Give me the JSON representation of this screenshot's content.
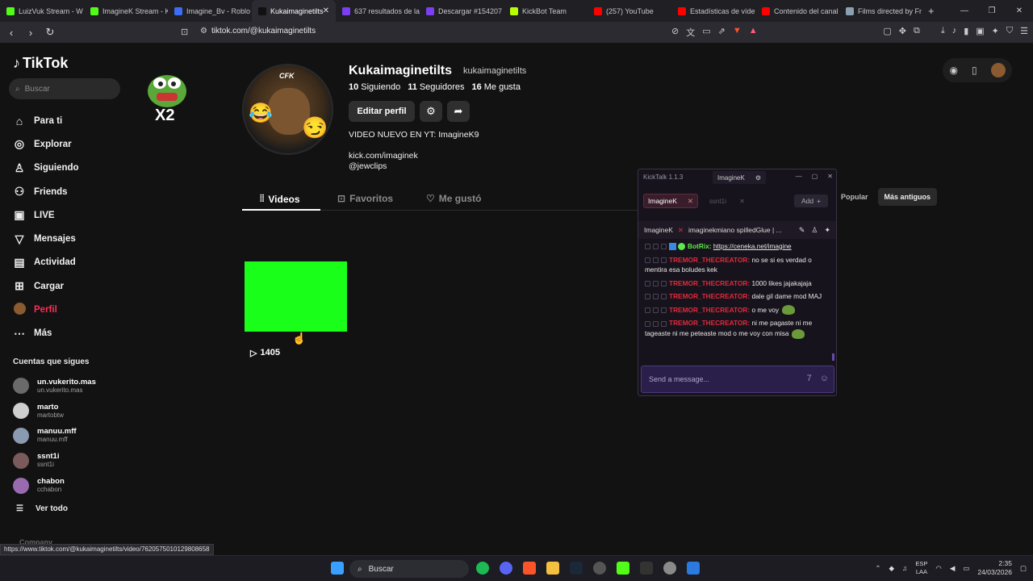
{
  "browser": {
    "tabs": [
      {
        "label": "LuizVuk Stream - W",
        "color": "#53fc18"
      },
      {
        "label": "ImagineK Stream - K",
        "color": "#53fc18"
      },
      {
        "label": "Imagine_Bv - Roblo",
        "color": "#3b6ef5"
      },
      {
        "label": "Kukaimaginetilts",
        "color": "#111111"
      },
      {
        "label": "637 resultados de la",
        "color": "#7b3ff2"
      },
      {
        "label": "Descargar #154207",
        "color": "#7b3ff2"
      },
      {
        "label": "KickBot Team",
        "color": "#b6ff00"
      },
      {
        "label": "(257) YouTube",
        "color": "#ff0000"
      },
      {
        "label": "Estadísticas de víde",
        "color": "#ff0000"
      },
      {
        "label": "Contenido del canal",
        "color": "#ff0000"
      },
      {
        "label": "Films directed by Fr",
        "color": "#8aa0b0"
      }
    ],
    "url": "tiktok.com/@kukaimaginetilts",
    "status_url": "https://www.tiktok.com/@kukaimaginetilts/video/7620575010129808658"
  },
  "sidebar": {
    "logo": "TikTok",
    "search_placeholder": "Buscar",
    "items": [
      {
        "label": "Para ti",
        "icon": "home-icon",
        "glyph": "⌂"
      },
      {
        "label": "Explorar",
        "icon": "compass-icon",
        "glyph": "◎"
      },
      {
        "label": "Siguiendo",
        "icon": "person-icon",
        "glyph": "♙"
      },
      {
        "label": "Friends",
        "icon": "friends-icon",
        "glyph": "⚇"
      },
      {
        "label": "LIVE",
        "icon": "live-icon",
        "glyph": "▣"
      },
      {
        "label": "Mensajes",
        "icon": "send-icon",
        "glyph": "▽"
      },
      {
        "label": "Actividad",
        "icon": "activity-icon",
        "glyph": "▤"
      },
      {
        "label": "Cargar",
        "icon": "upload-icon",
        "glyph": "⊞"
      },
      {
        "label": "Perfil",
        "icon": "avatar-icon",
        "glyph": "●"
      },
      {
        "label": "Más",
        "icon": "more-icon",
        "glyph": "⋯"
      }
    ],
    "following_title": "Cuentas que sigues",
    "following": [
      {
        "name": "un.vukerito.mas",
        "handle": "un.vukerito.mas"
      },
      {
        "name": "marto",
        "handle": "martobtw"
      },
      {
        "name": "manuu.mff",
        "handle": "manuu.mff"
      },
      {
        "name": "ssnt1i",
        "handle": "ssnt1i"
      },
      {
        "name": "chabon",
        "handle": "cchabon"
      }
    ],
    "see_all": "Ver todo",
    "company": "Company"
  },
  "profile": {
    "avatar_text": "CFK",
    "sticker_text": "X2",
    "username": "Kukaimaginetilts",
    "handle": "kukaimaginetilts",
    "following_count": "10",
    "following_label": "Siguiendo",
    "followers_count": "11",
    "followers_label": "Seguidores",
    "likes_count": "16",
    "likes_label": "Me gusta",
    "edit_button": "Editar perfil",
    "bio_lines": [
      "VIDEO NUEVO EN YT: ImagineK9",
      "",
      "kick.com/imaginek",
      "@jewclips"
    ],
    "tabs": [
      "Videos",
      "Favoritos",
      "Me gustó"
    ],
    "sort": [
      "Popular",
      "Más antiguos"
    ],
    "video_views": "1405",
    "video_color": "#19ff19"
  },
  "kicktalk": {
    "title": "KickTalk 1.1.3",
    "user": "ImagineK",
    "channels": [
      "ImagineK",
      "ssnt1i"
    ],
    "add_label": "Add",
    "header_channel": "ImagineK",
    "header_text": "imaginekmiano spilledGlue | ...",
    "messages": [
      {
        "nick": "BotRix:",
        "text": "https://ceneka.net/imagine",
        "bot": true
      },
      {
        "nick": "TREMOR_THECREATOR:",
        "text": "no se si es verdad o mentira esa boludes kek"
      },
      {
        "nick": "TREMOR_THECREATOR:",
        "text": "1000 likes jajakajaja"
      },
      {
        "nick": "TREMOR_THECREATOR:",
        "text": "dale gil dame mod MAJ"
      },
      {
        "nick": "TREMOR_THECREATOR:",
        "text": "o me voy"
      },
      {
        "nick": "TREMOR_THECREATOR:",
        "text": "ni me pagaste ni me tageaste ni me peteaste mod o me voy con misa"
      }
    ],
    "input_placeholder": "Send a message..."
  },
  "taskbar": {
    "search": "Buscar",
    "lang_top": "ESP",
    "lang_bottom": "LAA",
    "time": "2:35",
    "date": "24/03/2026"
  }
}
